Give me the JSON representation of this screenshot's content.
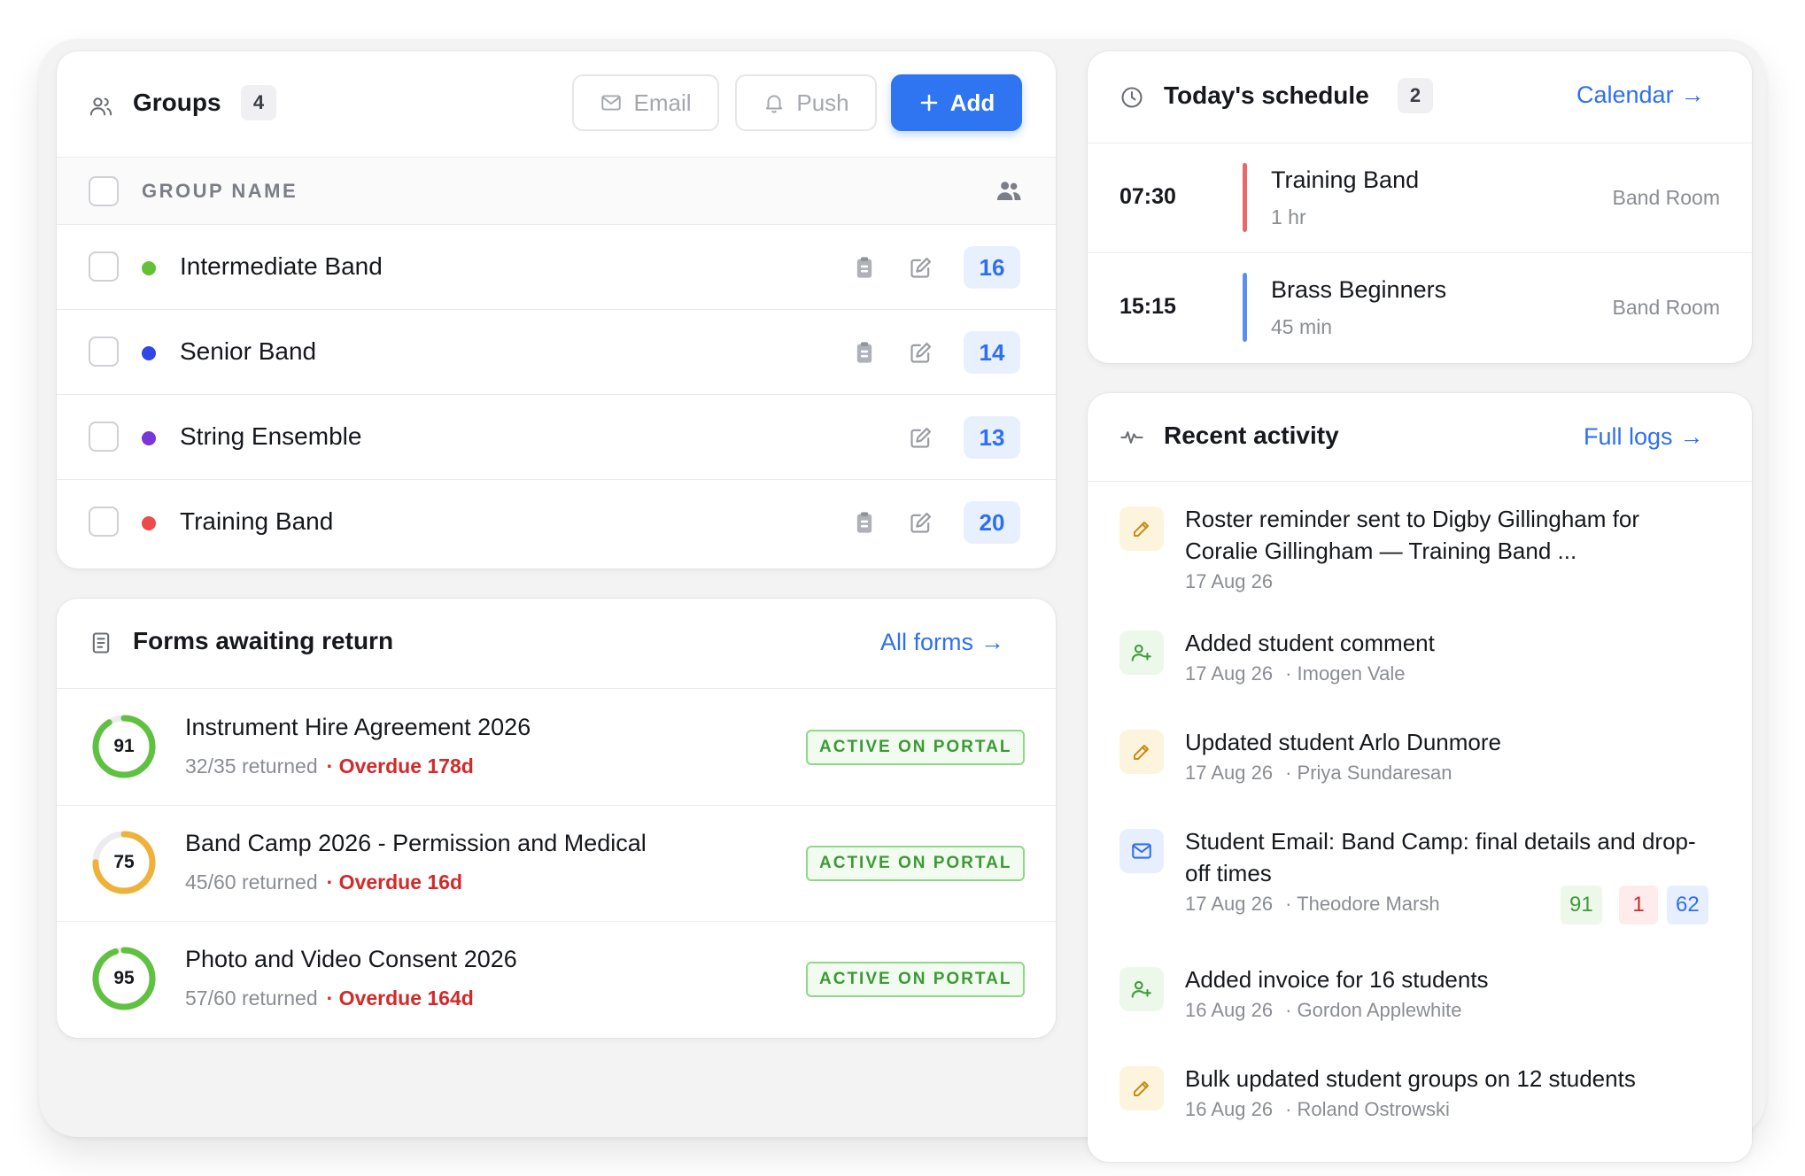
{
  "groups": {
    "title": "Groups",
    "count": "4",
    "email_label": "Email",
    "push_label": "Push",
    "add_label": "Add",
    "column_header": "GROUP NAME",
    "rows": [
      {
        "name": "Intermediate Band",
        "dot_color": "#62c234",
        "count": "16",
        "has_clipboard": true
      },
      {
        "name": "Senior Band",
        "dot_color": "#2f45e6",
        "count": "14",
        "has_clipboard": true
      },
      {
        "name": "String Ensemble",
        "dot_color": "#7a35d8",
        "count": "13",
        "has_clipboard": false
      },
      {
        "name": "Training Band",
        "dot_color": "#ea4c4c",
        "count": "20",
        "has_clipboard": true
      }
    ]
  },
  "forms": {
    "title": "Forms awaiting return",
    "link": "All forms",
    "rows": [
      {
        "score": "91",
        "percent": 91,
        "ring_color": "#5ec13f",
        "title": "Instrument Hire Agreement 2026",
        "returned": "32/35 returned",
        "overdue": "· Overdue 178d",
        "status": "ACTIVE ON PORTAL"
      },
      {
        "score": "75",
        "percent": 75,
        "ring_color": "#eeb23a",
        "title": "Band Camp 2026 - Permission and Medical",
        "returned": "45/60 returned",
        "overdue": "· Overdue 16d",
        "status": "ACTIVE ON PORTAL"
      },
      {
        "score": "95",
        "percent": 95,
        "ring_color": "#5ec13f",
        "title": "Photo and Video Consent 2026",
        "returned": "57/60 returned",
        "overdue": "· Overdue 164d",
        "status": "ACTIVE ON PORTAL"
      }
    ]
  },
  "schedule": {
    "title": "Today's schedule",
    "count": "2",
    "link": "Calendar",
    "items": [
      {
        "time": "07:30",
        "name": "Training Band",
        "duration": "1 hr",
        "room": "Band Room",
        "bar_color": "#e86868"
      },
      {
        "time": "15:15",
        "name": "Brass Beginners",
        "duration": "45 min",
        "room": "Band Room",
        "bar_color": "#5b8fef"
      }
    ]
  },
  "activity": {
    "title": "Recent activity",
    "link": "Full logs",
    "items": [
      {
        "icon": "pencil-icon",
        "text": "Roster reminder sent to Digby Gillingham for Coralie Gillingham — Training Band ...",
        "date": "17 Aug 26",
        "by": ""
      },
      {
        "icon": "user-plus-icon",
        "text": "Added student comment",
        "date": "17 Aug 26",
        "by": "· Imogen Vale"
      },
      {
        "icon": "pencil-icon",
        "text": "Updated student Arlo Dunmore",
        "date": "17 Aug 26",
        "by": "· Priya Sundaresan"
      },
      {
        "icon": "mail-icon",
        "text": "Student Email: Band Camp: final details and drop-off times",
        "date": "17 Aug 26",
        "by": "· Theodore Marsh",
        "stats": [
          "91",
          "1",
          "62"
        ]
      },
      {
        "icon": "user-plus-icon",
        "text": "Added invoice for 16 students",
        "date": "16 Aug 26",
        "by": "· Gordon Applewhite"
      },
      {
        "icon": "pencil-icon",
        "text": "Bulk updated student groups on 12 students",
        "date": "16 Aug 26",
        "by": "· Roland Ostrowski"
      }
    ]
  }
}
